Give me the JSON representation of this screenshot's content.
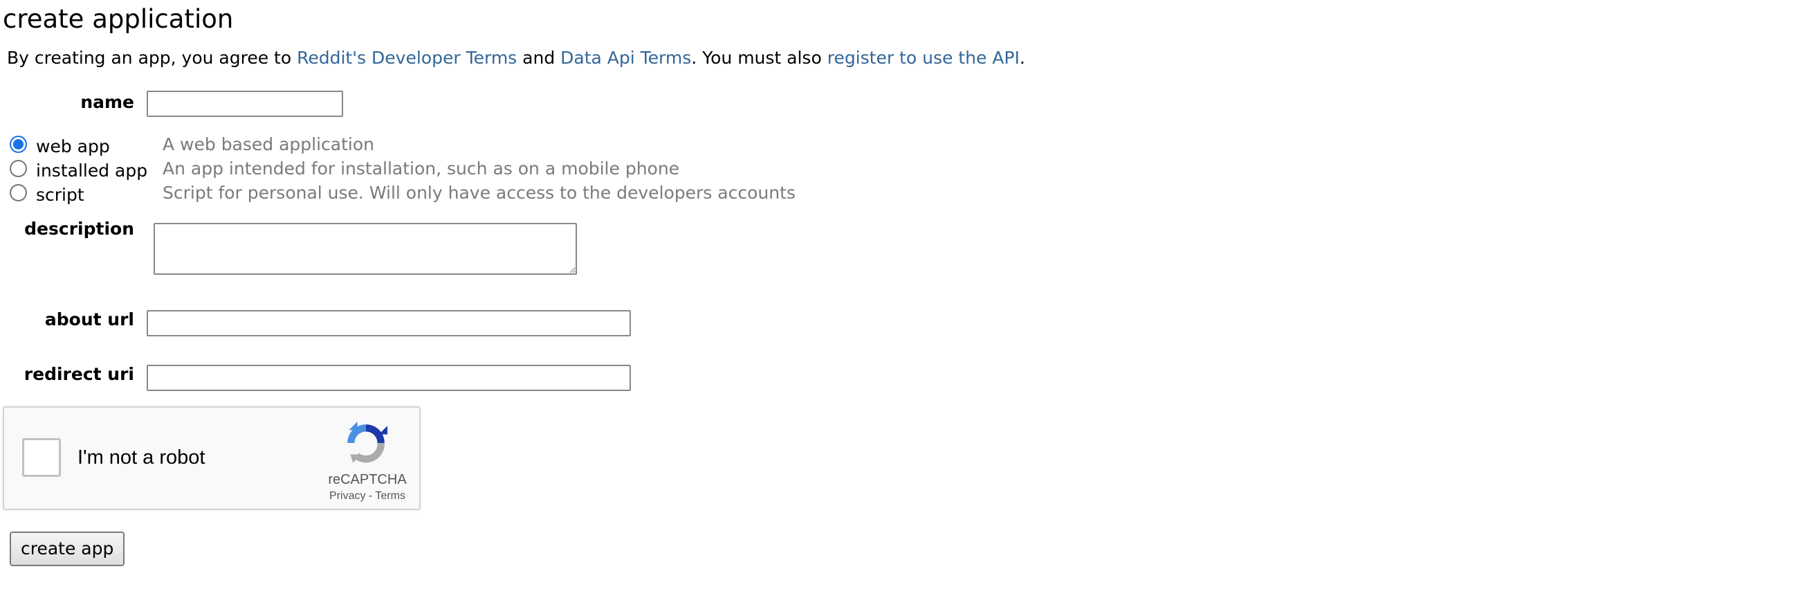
{
  "page": {
    "title": "create application"
  },
  "intro": {
    "prefix": "By creating an app, you agree to ",
    "developer_terms_link": "Reddit's Developer Terms",
    "and": " and ",
    "data_api_terms_link": "Data Api Terms",
    "middle": ". You must also ",
    "register_link": "register to use the API",
    "suffix": "."
  },
  "form": {
    "name": {
      "label": "name",
      "value": "",
      "placeholder": ""
    },
    "app_type": {
      "selected": "web app",
      "options": [
        {
          "label": "web app",
          "description": "A web based application",
          "checked": true
        },
        {
          "label": "installed app",
          "description": "An app intended for installation, such as on a mobile phone",
          "checked": false
        },
        {
          "label": "script",
          "description": "Script for personal use. Will only have access to the developers accounts",
          "checked": false
        }
      ]
    },
    "description": {
      "label": "description",
      "value": ""
    },
    "about_url": {
      "label": "about url",
      "value": ""
    },
    "redirect_uri": {
      "label": "redirect uri",
      "value": ""
    }
  },
  "recaptcha": {
    "checkbox_label": "I'm not a robot",
    "brand": "reCAPTCHA",
    "privacy_link": "Privacy",
    "separator": " - ",
    "terms_link": "Terms",
    "checked": false
  },
  "actions": {
    "create_button_label": "create app"
  },
  "colors": {
    "link": "#336699",
    "muted_text": "#7a7a7a",
    "radio_accent": "#1a73e8",
    "recaptcha_blue": "#4a90e2",
    "recaptcha_dark_blue": "#1c3aa9",
    "recaptcha_gray": "#ababab"
  },
  "icons": {
    "recaptcha_logo": "recaptcha-logo-icon"
  }
}
